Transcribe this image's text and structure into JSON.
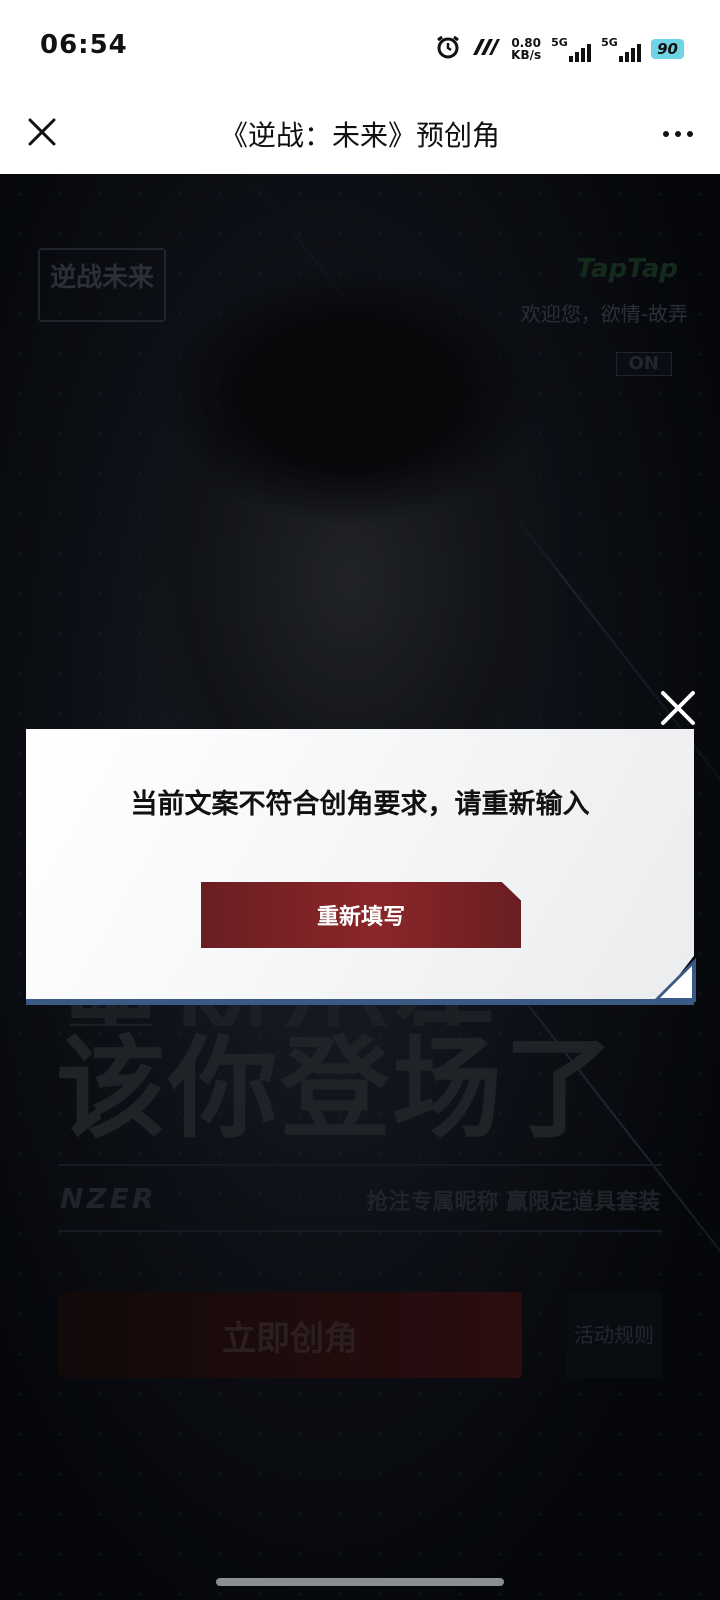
{
  "status_bar": {
    "time": "06:54",
    "net_speed_value": "0.80",
    "net_speed_unit": "KB/s",
    "sim1_tag": "5G",
    "sim2_tag": "5G",
    "battery": "90",
    "icons": [
      "alarm-icon",
      "vowifi-icon",
      "signal-icon",
      "signal-icon",
      "battery-icon"
    ]
  },
  "nav": {
    "title": "《逆战：未来》预创角",
    "close_icon": "close-icon",
    "more_icon": "more-icon"
  },
  "page": {
    "game_logo_text": "逆战未来",
    "brand_text": "TapTap",
    "welcome_text": "欢迎您，欲情-故弄",
    "toggle_on": "ON",
    "headline_line1": "黑风少年",
    "headline_line2": "该你登场了",
    "sub_brand": "NZER",
    "promo_text": "抢注专属昵称 赢限定道具套装",
    "create_button": "立即创角",
    "rules_button": "活动规则"
  },
  "modal": {
    "message": "当前文案不符合创角要求，请重新输入",
    "button": "重新填写",
    "accent_color": "#3a5a86",
    "button_color": "#7a2226"
  }
}
